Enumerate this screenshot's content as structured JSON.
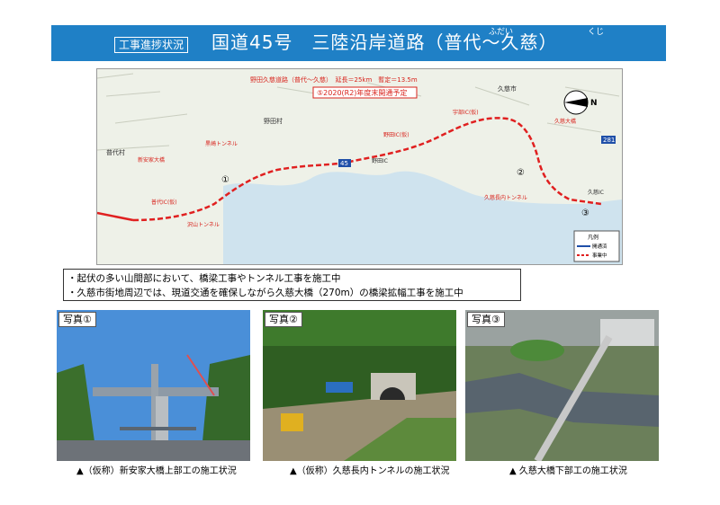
{
  "header": {
    "tag": "工事進捗状況",
    "title": "国道45号　三陸沿岸道路（普代～久慈）",
    "ruby_fudai": "ふだい",
    "ruby_kuji": "くじ"
  },
  "map": {
    "section_title": "野田久慈道路（普代～久慈）　延長＝25km　暫定＝13.5m",
    "opening_plan": "⑤2020(R2)年度末開通予定",
    "markers": [
      "①",
      "②",
      "③"
    ],
    "place_names": [
      "野田村",
      "久慈市",
      "普代村",
      "久慈IC",
      "野田IC"
    ],
    "route_shield": "45",
    "route_shield_east": "281",
    "structure_labels": [
      "新安家大橋",
      "久慈長内トンネル",
      "久慈大橋",
      "普代IC(仮)",
      "宇部IC(仮)",
      "野田IC(仮)",
      "沢山トンネル",
      "黒崎トンネル"
    ],
    "legend_title": "凡例",
    "legend_items": [
      "開通済",
      "事業中"
    ]
  },
  "notes": [
    "・起伏の多い山間部において、橋梁工事やトンネル工事を施工中",
    "・久慈市街地周辺では、現道交通を確保しながら久慈大橋（270m）の橋梁拡幅工事を施工中"
  ],
  "photos": [
    {
      "label": "写真①",
      "caption": "▲（仮称）新安家大橋上部工の施工状況"
    },
    {
      "label": "写真②",
      "caption": "▲（仮称）久慈長内トンネルの施工状況"
    },
    {
      "label": "写真③",
      "caption": "▲ 久慈大橋下部工の施工状況"
    }
  ],
  "colors": {
    "title_bg": "#1f80c6",
    "route": "#e02020",
    "opening_box": "#d8231c"
  }
}
